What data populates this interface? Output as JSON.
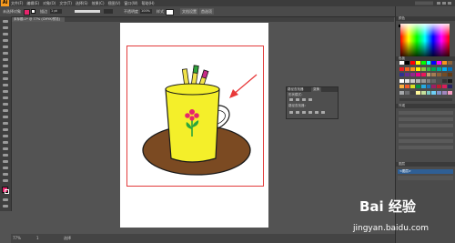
{
  "app": {
    "logo_text": "Ai",
    "menu": [
      "文件(F)",
      "编辑(E)",
      "对象(O)",
      "文字(T)",
      "选择(S)",
      "效果(C)",
      "视图(V)",
      "窗口(W)",
      "帮助(H)"
    ]
  },
  "control_bar": {
    "selection_label": "未选择对象",
    "stroke_label": "描边",
    "stroke_value": "1 pt",
    "opacity_label": "不透明度",
    "opacity_value": "100%",
    "style_label": "样式",
    "doc_setup_label": "文档设置",
    "preferences_label": "首选项"
  },
  "document": {
    "tab_title": "未标题-1* @ 77% (CMYK/预览)"
  },
  "status_bar": {
    "zoom": "77%",
    "page": "1",
    "tool_name": "选择"
  },
  "float_panel": {
    "tab1": "路径查找器",
    "tab2": "变换",
    "row1": "形状模式：",
    "row2": "路径查找器："
  },
  "right_panel": {
    "color_header": "颜色",
    "swatch_header": "色板",
    "appearance_header": "外观",
    "layers_header": "图层",
    "layer_name": "<图层>"
  },
  "watermark": {
    "brand": "Bai 经验",
    "url": "jingyan.baidu.com"
  },
  "colors": {
    "cup_yellow": "#f4ef2a",
    "saucer_brown": "#7b4a22",
    "frame_red": "#e23b3b",
    "arrow_red": "#e8393a",
    "handle_pink": "#c82c87",
    "handle_green": "#2fa33a",
    "handle_yellow": "#f1e24a",
    "flower_pink": "#e6256c",
    "stem_green": "#2aa63c",
    "ui_orange": "#f79a1e"
  },
  "swatches": [
    "#ffffff",
    "#000000",
    "#ff0000",
    "#ffff00",
    "#00ff00",
    "#00ffff",
    "#0000ff",
    "#ff00ff",
    "#f7931e",
    "#8c6239",
    "#ed1c24",
    "#f26522",
    "#f7941d",
    "#fff200",
    "#8dc63f",
    "#39b54a",
    "#00a651",
    "#00a99d",
    "#00aeef",
    "#0072bc",
    "#2e3192",
    "#662d91",
    "#92278f",
    "#ec008c",
    "#ed145b",
    "#c69c6d",
    "#a67c52",
    "#8c6239",
    "#754c24",
    "#603813",
    "#ffffff",
    "#e6e6e6",
    "#cccccc",
    "#b3b3b3",
    "#999999",
    "#808080",
    "#666666",
    "#4d4d4d",
    "#333333",
    "#1a1a1a",
    "#fbb040",
    "#f15a29",
    "#d7df23",
    "#009444",
    "#27aae1",
    "#1c75bc",
    "#9e1f63",
    "#be1e2d",
    "#da1c5c",
    "#262262",
    "#a7a9ac",
    "#6d6e71",
    "#414042",
    "#fff799",
    "#c4df9b",
    "#7accc8",
    "#6dcff6",
    "#8493ca",
    "#a186be",
    "#f49ac1"
  ]
}
